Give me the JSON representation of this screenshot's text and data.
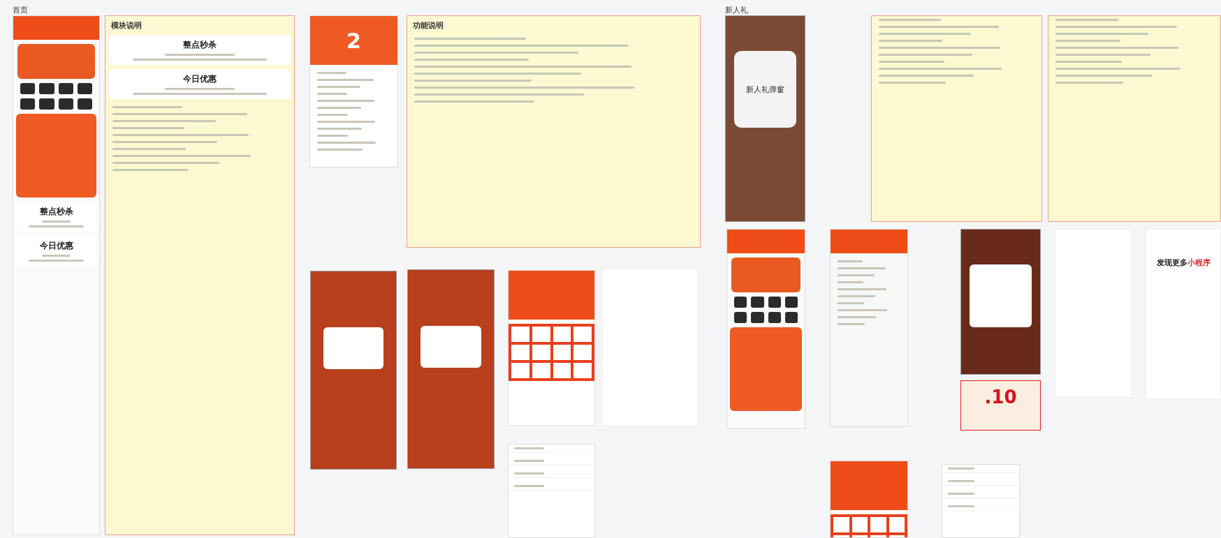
{
  "canvas": {
    "frames": [
      {
        "kind": "home",
        "label": "首页",
        "sections": [
          "整点秒杀",
          "今日优惠"
        ]
      },
      {
        "kind": "note",
        "title": "模块说明",
        "sections": [
          "整点秒杀",
          "今日优惠"
        ]
      },
      {
        "kind": "record",
        "number": "2"
      },
      {
        "kind": "note",
        "title": "功能说明"
      },
      {
        "kind": "dialog-phone"
      },
      {
        "kind": "dialog-phone"
      },
      {
        "kind": "brand-wall"
      },
      {
        "kind": "blank"
      },
      {
        "kind": "store-list"
      },
      {
        "kind": "popup-phone",
        "label": "新人礼",
        "popup": "新人礼弹窗"
      },
      {
        "kind": "note"
      },
      {
        "kind": "note"
      },
      {
        "kind": "home"
      },
      {
        "kind": "gift-page"
      },
      {
        "kind": "dark-popup"
      },
      {
        "kind": "coupon",
        "amount": ".10"
      },
      {
        "kind": "blank"
      },
      {
        "kind": "mini-program",
        "heading": "发现更多",
        "accent": "小程序"
      },
      {
        "kind": "brand-wall"
      },
      {
        "kind": "store-list"
      }
    ]
  }
}
